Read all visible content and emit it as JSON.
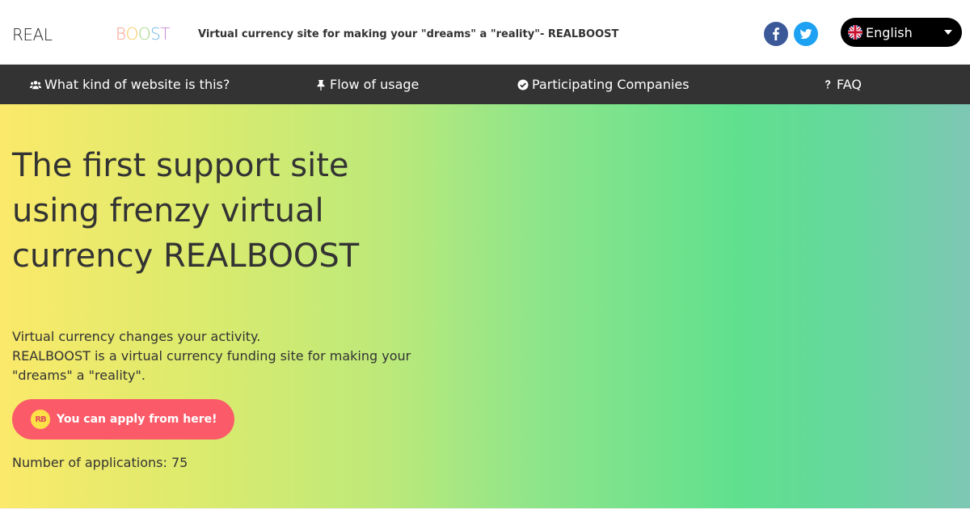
{
  "header": {
    "logo_real": "REAL",
    "logo_boost_letters": [
      "B",
      "O",
      "O",
      "S",
      "T"
    ],
    "logo_boost_colors": [
      "#f49a8a",
      "#f7c54e",
      "#9ed27c",
      "#6fb6e6",
      "#c98ad8"
    ],
    "tagline": "Virtual currency site for making your \"dreams\" a \"reality\"- REALBOOST",
    "social": {
      "facebook_icon": "facebook-icon",
      "twitter_icon": "twitter-icon"
    },
    "language": {
      "selected": "English",
      "flag_icon": "uk-flag-icon"
    }
  },
  "nav": {
    "items": [
      {
        "label": "What kind of website is this?",
        "icon": "users-icon"
      },
      {
        "label": "Flow of usage",
        "icon": "thumbtack-icon"
      },
      {
        "label": "Participating Companies",
        "icon": "check-circle-icon"
      },
      {
        "label": "FAQ",
        "icon": "question-icon"
      }
    ],
    "background": "#333333"
  },
  "hero": {
    "title": "The first support site using frenzy virtual currency REALBOOST",
    "desc_line1": "Virtual currency changes your activity.",
    "desc_line2": "REALBOOST is a virtual currency funding site for making your \"dreams\" a \"reality\".",
    "apply_button": "You can apply from here!",
    "apply_icon_text": "RB",
    "count_label": "Number of applications:",
    "count_value": "75",
    "button_color": "#fb5b69"
  }
}
